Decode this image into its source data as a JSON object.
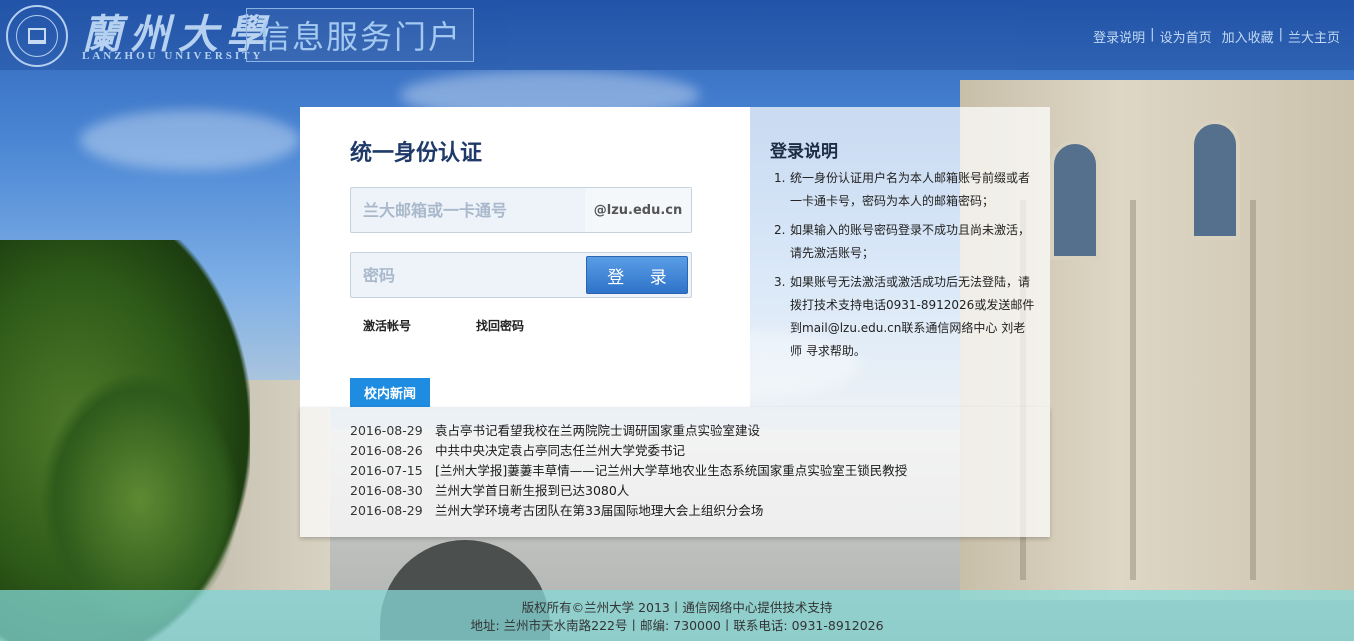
{
  "header": {
    "logo_cn": "蘭州大學",
    "logo_en": "LANZHOU UNIVERSITY",
    "portal_title": "信息服务门户",
    "links": [
      "登录说明",
      "设为首页",
      "加入收藏",
      "兰大主页"
    ]
  },
  "login": {
    "title": "统一身份认证",
    "username_placeholder": "兰大邮箱或一卡通号",
    "email_suffix": "@lzu.edu.cn",
    "password_placeholder": "密码",
    "login_button": "登 录",
    "activate_link": "激活帐号",
    "retrieve_link": "找回密码"
  },
  "help": {
    "title": "登录说明",
    "items": [
      {
        "num": "1.",
        "text": "统一身份认证用户名为本人邮箱账号前缀或者一卡通卡号，密码为本人的邮箱密码；"
      },
      {
        "num": "2.",
        "text": "如果输入的账号密码登录不成功且尚未激活，请先激活账号；"
      },
      {
        "num": "3.",
        "text": "如果账号无法激活或激活成功后无法登陆，请拨打技术支持电话0931-8912026或发送邮件到mail@lzu.edu.cn联系通信网络中心 刘老师 寻求帮助。"
      }
    ]
  },
  "news": {
    "tab": "校内新闻",
    "items": [
      {
        "date": "2016-08-29",
        "title": "袁占亭书记看望我校在兰两院院士调研国家重点实验室建设"
      },
      {
        "date": "2016-08-26",
        "title": "中共中央决定袁占亭同志任兰州大学党委书记"
      },
      {
        "date": "2016-07-15",
        "title": "[兰州大学报]萋萋丰草情——记兰州大学草地农业生态系统国家重点实验室王锁民教授"
      },
      {
        "date": "2016-08-30",
        "title": "兰州大学首日新生报到已达3080人"
      },
      {
        "date": "2016-08-29",
        "title": "兰州大学环境考古团队在第33届国际地理大会上组织分会场"
      }
    ]
  },
  "footer": {
    "line1": "版权所有©兰州大学 2013丨通信网络中心提供技术支持",
    "line2": "地址: 兰州市天水南路222号丨邮编: 730000丨联系电话: 0931-8912026"
  },
  "colors": {
    "header_bg": "#2153a8",
    "accent": "#1e8ce0",
    "footer_bg": "#86dcdc"
  }
}
